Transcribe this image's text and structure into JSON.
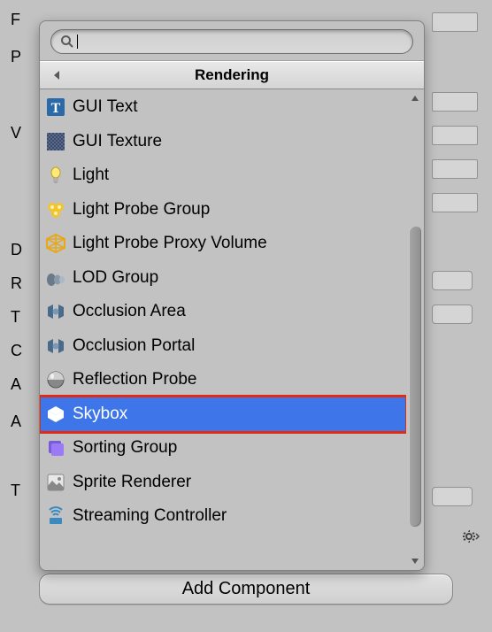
{
  "background": {
    "labels": [
      "F",
      "P",
      "V",
      "D",
      "R",
      "T",
      "C",
      "A",
      "A",
      "T"
    ]
  },
  "popover": {
    "search": {
      "value": "",
      "placeholder": ""
    },
    "header": {
      "title": "Rendering"
    },
    "items": [
      {
        "label": "GUI Text",
        "icon": "gui-text",
        "selected": false
      },
      {
        "label": "GUI Texture",
        "icon": "gui-texture",
        "selected": false
      },
      {
        "label": "Light",
        "icon": "light",
        "selected": false
      },
      {
        "label": "Light Probe Group",
        "icon": "light-probe-group",
        "selected": false
      },
      {
        "label": "Light Probe Proxy Volume",
        "icon": "light-probe-proxy",
        "selected": false
      },
      {
        "label": "LOD Group",
        "icon": "lod-group",
        "selected": false
      },
      {
        "label": "Occlusion Area",
        "icon": "occlusion-area",
        "selected": false
      },
      {
        "label": "Occlusion Portal",
        "icon": "occlusion-portal",
        "selected": false
      },
      {
        "label": "Reflection Probe",
        "icon": "reflection-probe",
        "selected": false
      },
      {
        "label": "Skybox",
        "icon": "skybox",
        "selected": true
      },
      {
        "label": "Sorting Group",
        "icon": "sorting-group",
        "selected": false
      },
      {
        "label": "Sprite Renderer",
        "icon": "sprite-renderer",
        "selected": false
      },
      {
        "label": "Streaming Controller",
        "icon": "streaming-controller",
        "selected": false
      }
    ]
  },
  "addComponent": {
    "label": "Add Component"
  }
}
